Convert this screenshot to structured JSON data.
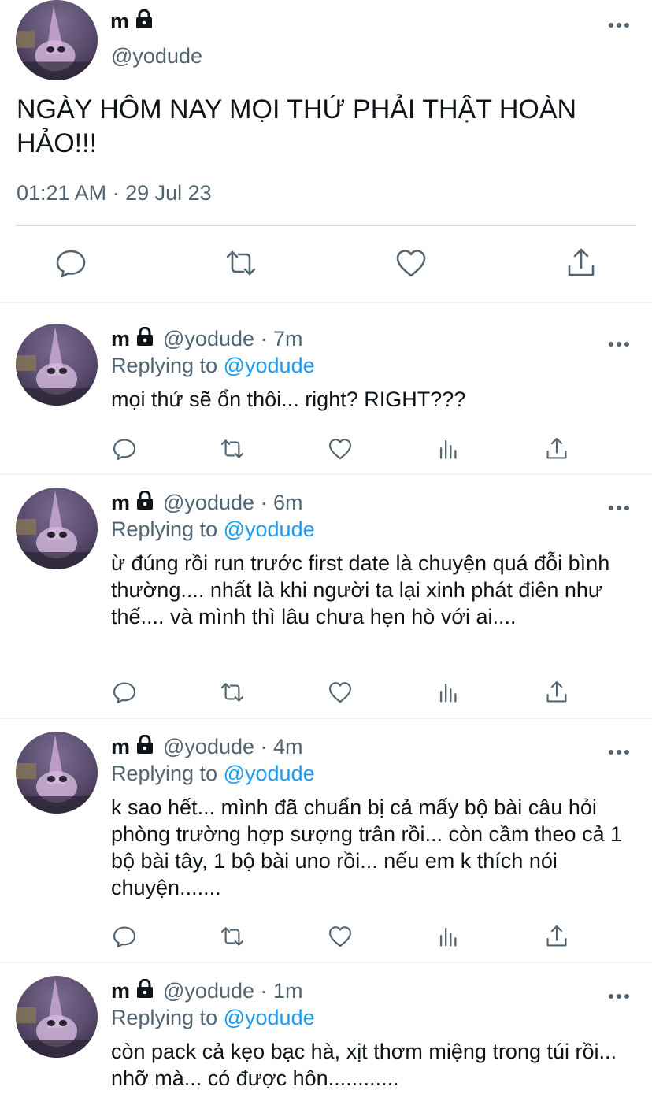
{
  "main_tweet": {
    "author_name": "m",
    "author_handle": "@yodude",
    "text": "NGÀY HÔM NAY MỌI THỨ PHẢI THẬT HOÀN HẢO!!!",
    "timestamp": "01:21 AM · 29 Jul 23"
  },
  "replies": [
    {
      "author_name": "m",
      "handle_time": "@yodude · 7m",
      "replying_prefix": "Replying to",
      "replying_to": "@yodude",
      "text": "mọi thứ sẽ ổn thôi... right? RIGHT???"
    },
    {
      "author_name": "m",
      "handle_time": "@yodude · 6m",
      "replying_prefix": "Replying to",
      "replying_to": "@yodude",
      "text": "ừ đúng rồi run trước first date là chuyện quá đỗi bình thường.... nhất là khi người ta lại xinh phát điên như thế.... và mình thì lâu chưa hẹn hò với ai...."
    },
    {
      "author_name": "m",
      "handle_time": "@yodude · 4m",
      "replying_prefix": "Replying to",
      "replying_to": "@yodude",
      "text": "k sao hết... mình đã chuẩn bị cả mấy bộ bài câu hỏi phòng trường hợp sượng trân rồi... còn cầm theo cả 1 bộ bài tây, 1 bộ bài uno rồi... nếu em k thích nói chuyện......."
    },
    {
      "author_name": "m",
      "handle_time": "@yodude · 1m",
      "replying_prefix": "Replying to",
      "replying_to": "@yodude",
      "text": "còn pack cả kẹo bạc hà, xịt thơm miệng trong túi rồi... nhỡ mà... có được hôn............"
    }
  ],
  "icons": {
    "lock": "lock-icon",
    "more": "more-horizontal-icon",
    "reply": "reply-bubble-icon",
    "retweet": "retweet-icon",
    "like": "heart-icon",
    "analytics": "analytics-bars-icon",
    "share": "share-upload-icon"
  },
  "colors": {
    "text": "#0f1419",
    "secondary": "#536471",
    "accent": "#1d9bf0",
    "divider": "#eff3f4"
  }
}
